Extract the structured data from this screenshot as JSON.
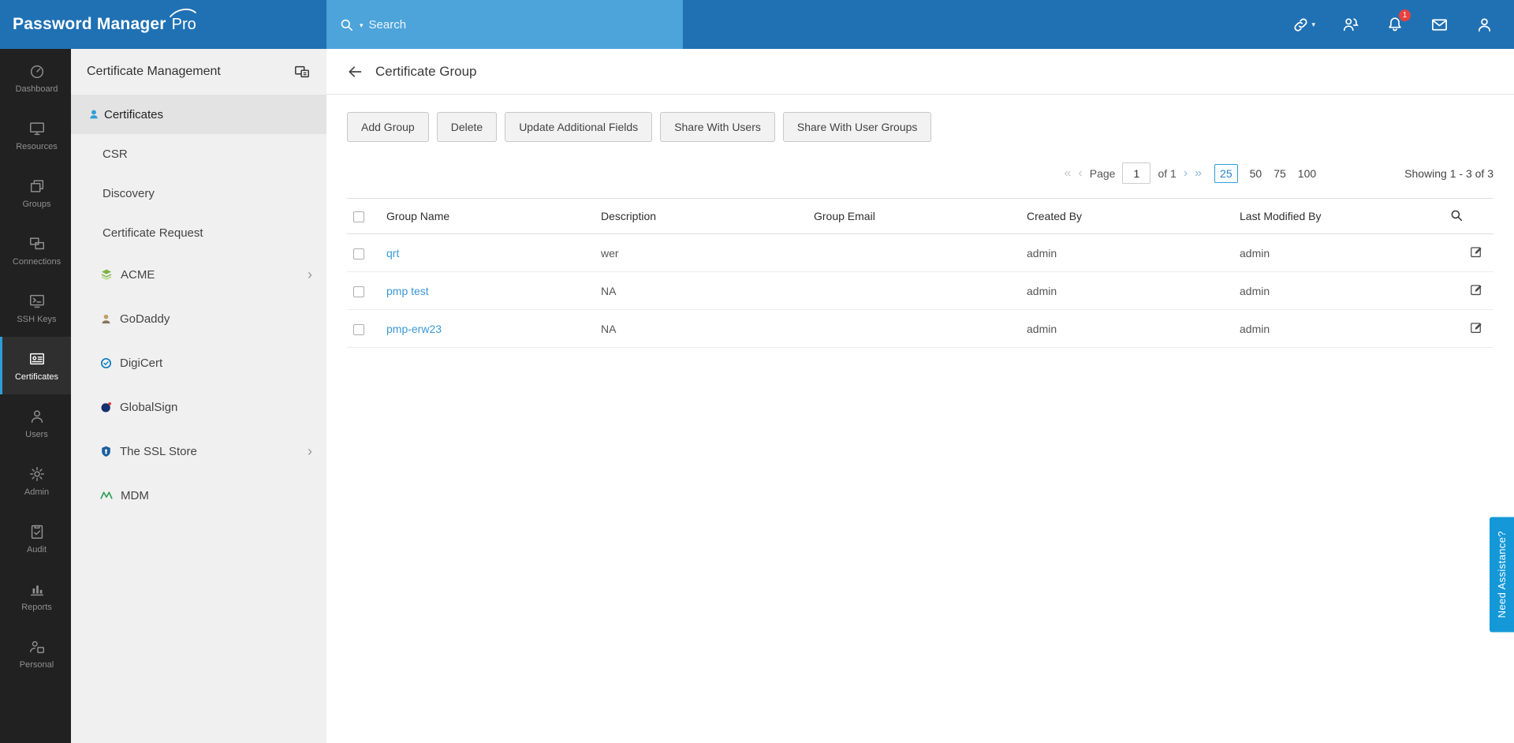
{
  "topbar": {
    "logo_primary": "Password Manager",
    "logo_suffix": "Pro",
    "search": {
      "placeholder": "Search"
    },
    "notification_badge": "1"
  },
  "rail": {
    "active_item": "Certificates",
    "items": [
      {
        "label": "Dashboard"
      },
      {
        "label": "Resources"
      },
      {
        "label": "Groups"
      },
      {
        "label": "Connections"
      },
      {
        "label": "SSH Keys"
      },
      {
        "label": "Certificates"
      },
      {
        "label": "Users"
      },
      {
        "label": "Admin"
      },
      {
        "label": "Audit"
      },
      {
        "label": "Reports"
      },
      {
        "label": "Personal"
      }
    ]
  },
  "sidebar": {
    "title": "Certificate Management",
    "active_item": "Certificates",
    "items": [
      {
        "label": "Certificates"
      },
      {
        "label": "CSR"
      },
      {
        "label": "Discovery"
      },
      {
        "label": "Certificate Request"
      },
      {
        "label": "ACME"
      },
      {
        "label": "GoDaddy"
      },
      {
        "label": "DigiCert"
      },
      {
        "label": "GlobalSign"
      },
      {
        "label": "The SSL Store"
      },
      {
        "label": "MDM"
      }
    ]
  },
  "main": {
    "title": "Certificate Group",
    "toolbar": {
      "add_group": "Add Group",
      "delete": "Delete",
      "update_additional_fields": "Update Additional Fields",
      "share_with_users": "Share With Users",
      "share_with_user_groups": "Share With User Groups"
    },
    "pagination": {
      "first": "«",
      "prev": "‹",
      "page_label": "Page",
      "page_value": "1",
      "of_label": "of 1",
      "next": "›",
      "last": "»",
      "sizes": [
        "25",
        "50",
        "75",
        "100"
      ],
      "selected_size": "25",
      "showing": "Showing 1 - 3 of 3"
    },
    "table": {
      "columns": [
        "Group Name",
        "Description",
        "Group Email",
        "Created By",
        "Last Modified By"
      ],
      "rows": [
        {
          "name": "qrt",
          "description": "wer",
          "email": "",
          "created_by": "admin",
          "modified_by": "admin"
        },
        {
          "name": "pmp test",
          "description": "NA",
          "email": "",
          "created_by": "admin",
          "modified_by": "admin"
        },
        {
          "name": "pmp-erw23",
          "description": "NA",
          "email": "",
          "created_by": "admin",
          "modified_by": "admin"
        }
      ]
    }
  },
  "assist": {
    "label": "Need Assistance?"
  },
  "icons": {
    "caret-down-icon": "▾",
    "chevron-right-icon": "›",
    "search-icon": "magnifier",
    "quick-links-icon": "chain-link",
    "user-alert-icon": "person-bell",
    "notification-bell-icon": "bell",
    "mail-icon": "envelope",
    "profile-icon": "person",
    "dashboard-icon": "gauge",
    "resources-icon": "monitor",
    "groups-icon": "stacked-folders",
    "connections-icon": "dual-monitors",
    "ssh-keys-icon": "terminal",
    "certificates-icon": "id-card",
    "users-icon": "person",
    "admin-icon": "gear",
    "audit-icon": "clipboard-check",
    "reports-icon": "bar-chart",
    "personal-icon": "person-card",
    "back-icon": "arrow-left",
    "edit-icon": "pencil-square",
    "table-search-icon": "magnifier"
  },
  "colors": {
    "topbar": "#2071b3",
    "search_field": "#4ca4da",
    "accent": "#2e9fd8",
    "link": "#3b97d3",
    "badge": "#e8413c",
    "assist_tab": "#1598d8"
  }
}
